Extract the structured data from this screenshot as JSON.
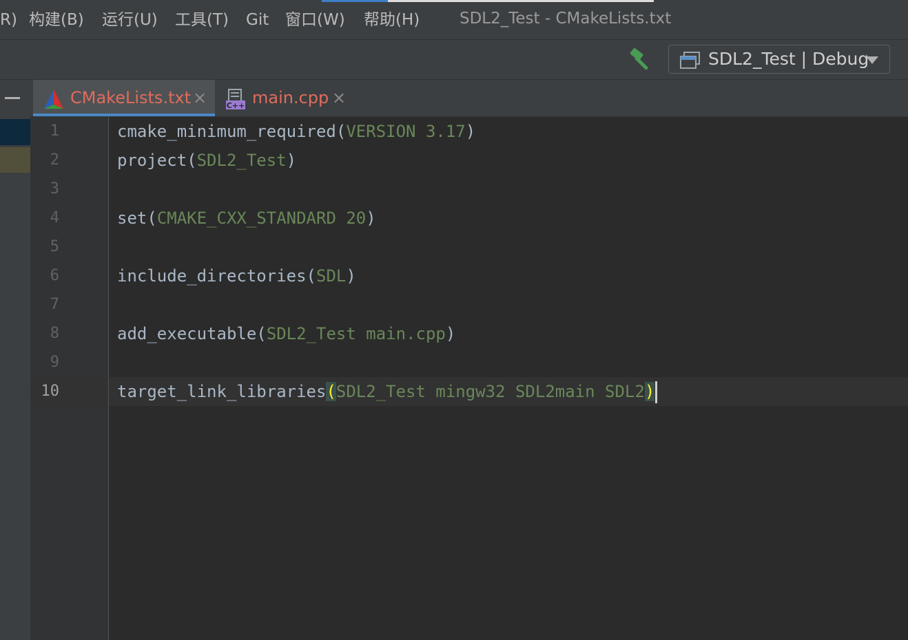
{
  "menubar": {
    "items": [
      {
        "label": "R)"
      },
      {
        "label": "构建(B)"
      },
      {
        "label": "运行(U)"
      },
      {
        "label": "工具(T)"
      },
      {
        "label": "Git"
      },
      {
        "label": "窗口(W)"
      },
      {
        "label": "帮助(H)"
      }
    ],
    "window_title": "SDL2_Test - CMakeLists.txt"
  },
  "toolbar": {
    "build_icon": "hammer-icon",
    "config": {
      "label": "SDL2_Test | Debug",
      "icon": "window-config-icon"
    }
  },
  "tabs": [
    {
      "label": "CMakeLists.txt",
      "icon": "cmake-triangle-icon",
      "active": true,
      "close": "×"
    },
    {
      "label": "main.cpp",
      "icon": "cpp-file-icon",
      "active": false,
      "close": "×"
    }
  ],
  "colors": {
    "tab_label": "#e06c5c",
    "argument": "#6a8759",
    "identifier": "#a9b7c6",
    "build_icon": "#499c54"
  },
  "editor": {
    "current_line": 10,
    "lines": [
      {
        "num": "1",
        "name": "cmake_minimum_required",
        "open": "(",
        "args": "VERSION 3.17",
        "close": ")"
      },
      {
        "num": "2",
        "name": "project",
        "open": "(",
        "args": "SDL2_Test",
        "close": ")"
      },
      {
        "num": "3",
        "name": "",
        "open": "",
        "args": "",
        "close": ""
      },
      {
        "num": "4",
        "name": "set",
        "open": "(",
        "args": "CMAKE_CXX_STANDARD 20",
        "close": ")"
      },
      {
        "num": "5",
        "name": "",
        "open": "",
        "args": "",
        "close": ""
      },
      {
        "num": "6",
        "name": "include_directories",
        "open": "(",
        "args": "SDL",
        "close": ")"
      },
      {
        "num": "7",
        "name": "",
        "open": "",
        "args": "",
        "close": ""
      },
      {
        "num": "8",
        "name": "add_executable",
        "open": "(",
        "args": "SDL2_Test main.cpp",
        "close": ")"
      },
      {
        "num": "9",
        "name": "",
        "open": "",
        "args": "",
        "close": ""
      },
      {
        "num": "10",
        "name": "target_link_libraries",
        "open": "(",
        "args": "SDL2_Test mingw32 SDL2main SDL2",
        "close": ")"
      }
    ]
  }
}
